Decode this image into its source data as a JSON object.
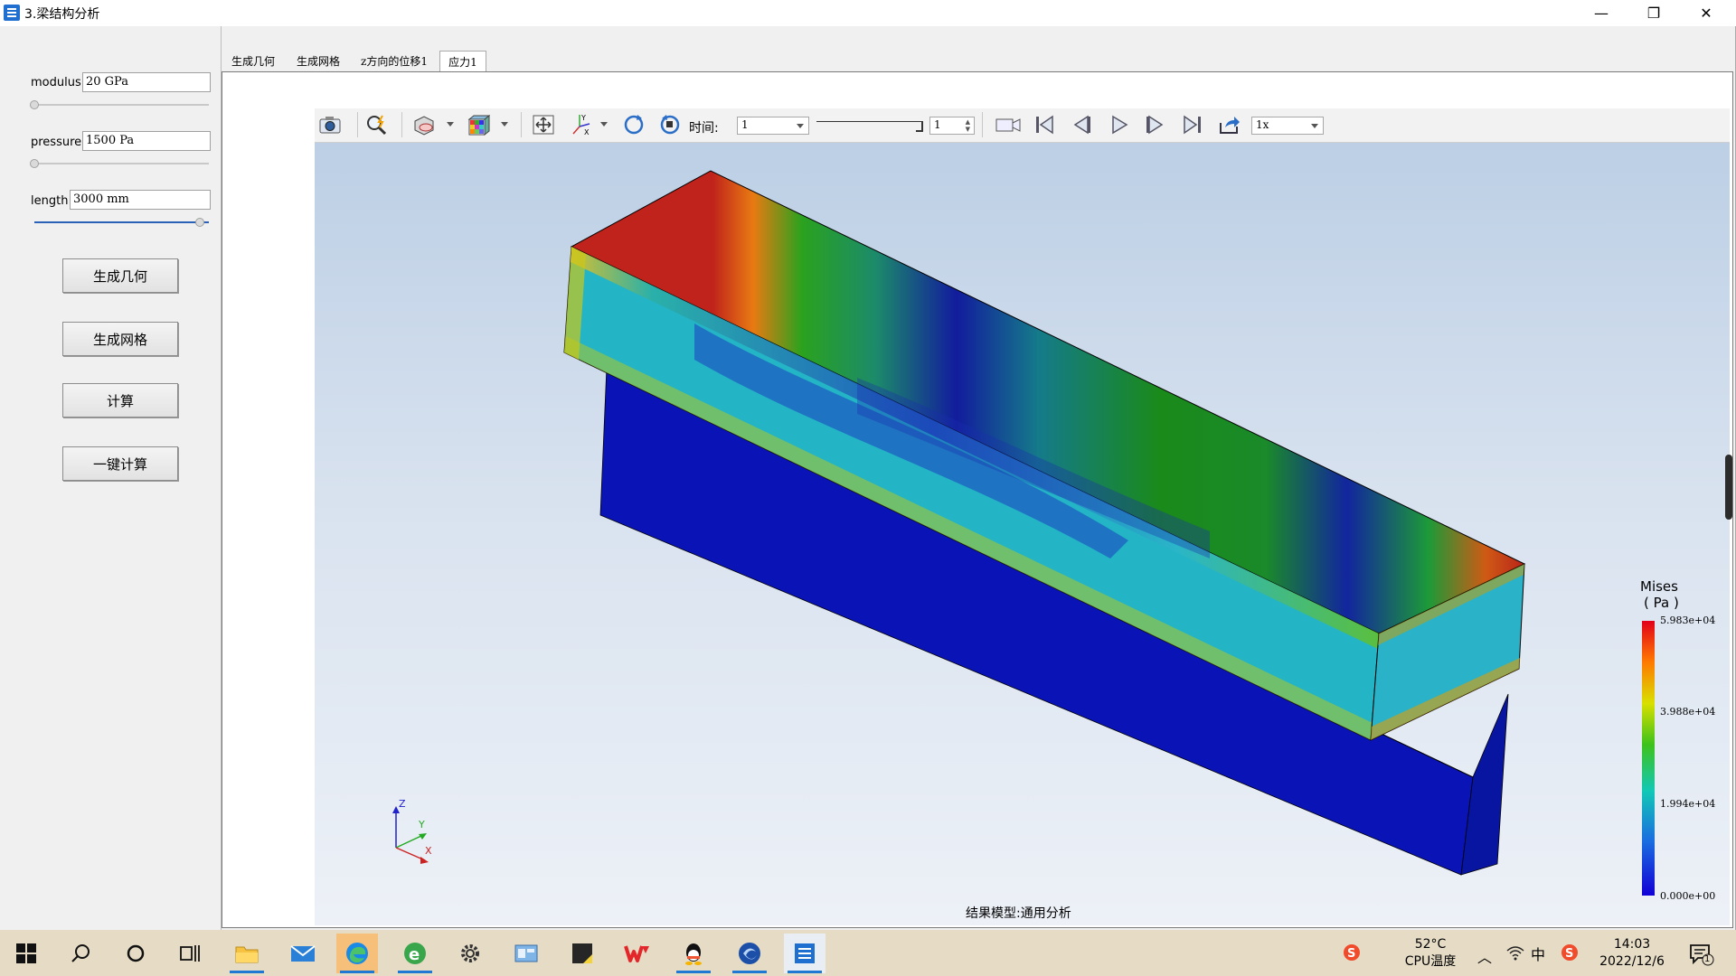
{
  "window": {
    "title": "3.梁结构分析",
    "minimize": "—",
    "restore": "❐",
    "close": "✕"
  },
  "params": {
    "modulus": {
      "label": "modulus",
      "value": "20 GPa",
      "slider": 0.0
    },
    "pressure": {
      "label": "pressure",
      "value": "1500 Pa",
      "slider": 0.0
    },
    "length": {
      "label": "length",
      "value": "3000 mm",
      "slider": 1.0
    }
  },
  "buttons": {
    "geometry": "生成几何",
    "mesh": "生成网格",
    "compute": "计算",
    "one_click": "一键计算"
  },
  "tabs": [
    "生成几何",
    "生成网格",
    "z方向的位移1",
    "应力1"
  ],
  "toolbar": {
    "time_label": "时间:",
    "time_value": "1",
    "frame_value": "1",
    "speed_value": "1x"
  },
  "legend": {
    "title": "Mises",
    "unit": "( Pa )",
    "ticks": [
      "5.983e+04",
      "3.988e+04",
      "1.994e+04",
      "0.000e+00"
    ]
  },
  "axes": {
    "z": "Z",
    "y": "Y",
    "x": "X"
  },
  "status": "结果模型:通用分析",
  "taskbar": {
    "temp": "52°C",
    "temp_label": "CPU温度",
    "time": "14:03",
    "date": "2022/12/6",
    "notif": "1",
    "ime": "中"
  },
  "colors": {
    "accent": "#1e6fcf",
    "taskbar": "#e6dcc6"
  }
}
